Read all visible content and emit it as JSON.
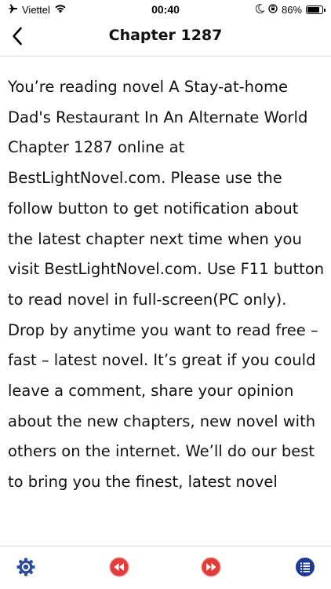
{
  "status_bar": {
    "carrier": "Viettel",
    "time": "00:40",
    "battery_percent": "86%",
    "battery_level": 0.86,
    "icons": [
      "airplane-icon",
      "wifi-icon",
      "moon-icon",
      "orientation-lock-icon",
      "battery-icon"
    ]
  },
  "nav": {
    "back_icon": "chevron-left-icon",
    "title": "Chapter 1287"
  },
  "content": {
    "text": "You’re reading novel A Stay-at-home Dad's Restaurant In An Alternate World Chapter 1287 online at BestLightNovel.com. Please use the follow button to get notification about the latest chapter next time when you visit BestLightNovel.com. Use F11 button to read novel in full-screen(PC only). Drop by anytime you want to read free – fast – latest novel. It’s great if you could leave a comment, share your opinion about the new chapters, new novel with others on the internet. We’ll do our best to bring you the finest, latest novel"
  },
  "toolbar": {
    "items": [
      {
        "icon": "settings-gear-icon"
      },
      {
        "icon": "previous-chapter-icon"
      },
      {
        "icon": "next-chapter-icon"
      },
      {
        "icon": "chapter-list-icon"
      }
    ],
    "colors": {
      "settings": "#2c4a9e",
      "prev": "#e23b3b",
      "next": "#e23b3b",
      "list": "#1f3a93"
    }
  }
}
